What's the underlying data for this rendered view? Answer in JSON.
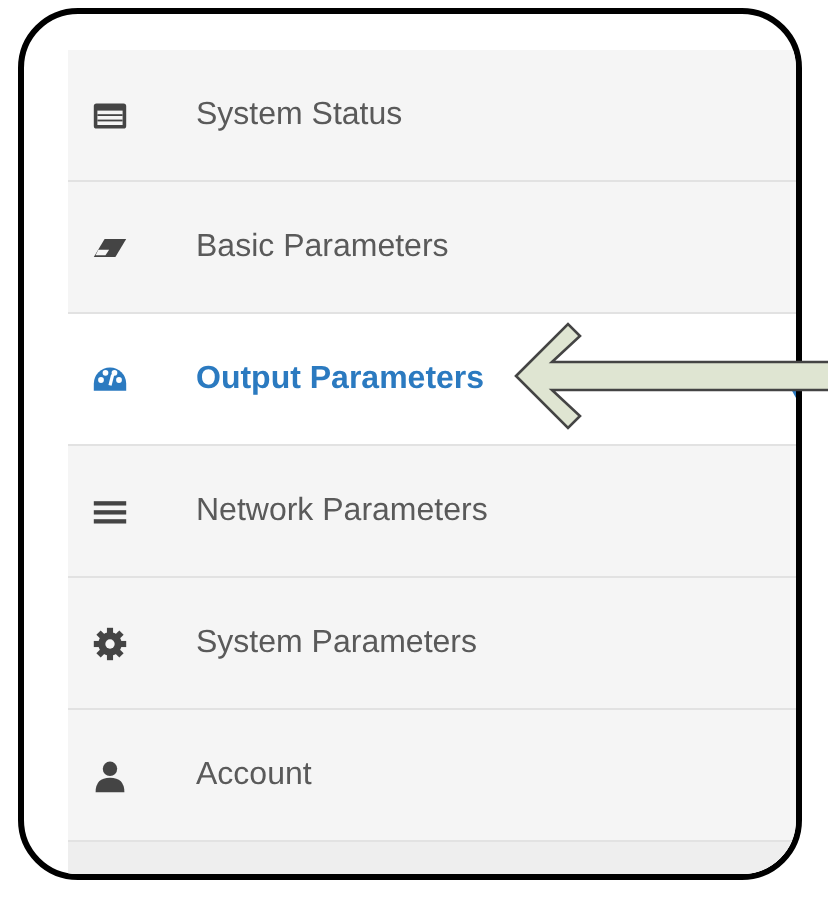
{
  "sidebar": {
    "items": [
      {
        "label": "System Status",
        "selected": false
      },
      {
        "label": "Basic Parameters",
        "selected": false
      },
      {
        "label": "Output Parameters",
        "selected": true
      },
      {
        "label": "Network Parameters",
        "selected": false
      },
      {
        "label": "System Parameters",
        "selected": false
      },
      {
        "label": "Account",
        "selected": false
      }
    ]
  }
}
